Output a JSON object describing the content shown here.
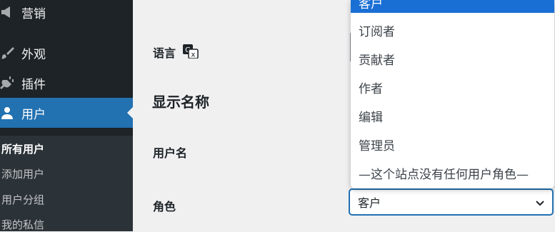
{
  "sidebar": {
    "items": [
      {
        "label": "营销",
        "icon": "megaphone-icon"
      },
      {
        "label": "外观",
        "icon": "paintbrush-icon"
      },
      {
        "label": "插件",
        "icon": "plug-icon"
      },
      {
        "label": "用户",
        "icon": "user-icon",
        "active": true
      }
    ],
    "submenu": [
      "所有用户",
      "添加用户",
      "用户分组",
      "我的私信"
    ]
  },
  "form": {
    "language_label": "语言",
    "display_name_heading": "显示名称",
    "username_label": "用户名",
    "role_label": "角色",
    "role_value": "客户"
  },
  "role_dropdown": {
    "options": [
      "客户",
      "订阅者",
      "贡献者",
      "作者",
      "编辑",
      "管理员",
      "—这个站点没有任何用户角色—"
    ],
    "selected": "客户"
  },
  "colors": {
    "sidebar_bg": "#1d2327",
    "active_menu": "#2271b1",
    "selected_option": "#1a6fd4"
  }
}
